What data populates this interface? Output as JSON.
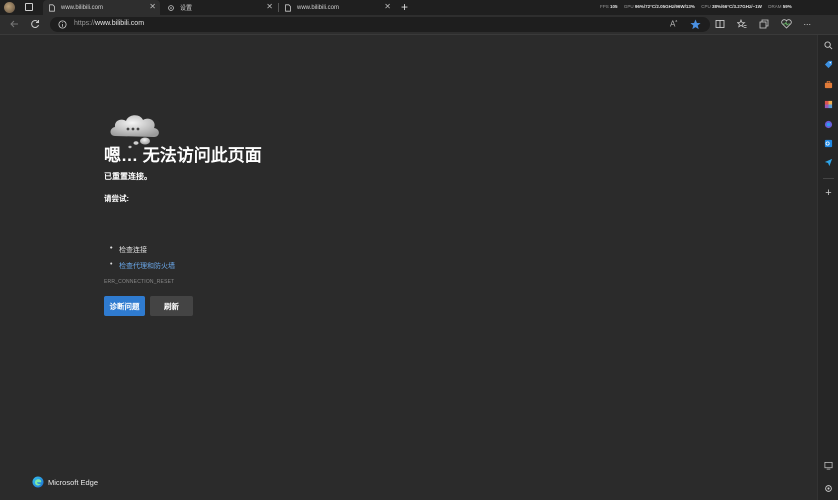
{
  "tabs": [
    {
      "title": "www.bilibili.com",
      "icon": "page-loading-icon",
      "active": true
    },
    {
      "title": "设置",
      "icon": "gear-icon",
      "active": false
    },
    {
      "title": "www.bilibili.com",
      "icon": "page-loading-icon",
      "active": false
    }
  ],
  "new_tab": "+",
  "stats": {
    "fps_label": "FPS",
    "fps_value": "105",
    "gpu_label": "GPU",
    "gpu_value": "96%/72°C/2.05GHz/96W/13%",
    "cpu_label": "CPU",
    "cpu_value": "38%/66°C/3.27GHz/~1W",
    "ram_label": "DRAM",
    "ram_value": "59%"
  },
  "address": {
    "url": "https://www.bilibili.com",
    "protocol": "https://",
    "host": "www.bilibili.com"
  },
  "error": {
    "title": "嗯… 无法访问此页面",
    "subtitle": "已重置连接。",
    "try_label": "请尝试:",
    "suggestions": [
      "检查连接",
      "检查代理和防火墙"
    ],
    "code": "ERR_CONNECTION_RESET",
    "diagnose_label": "诊断问题",
    "refresh_label": "刷新"
  },
  "footer": {
    "brand": "Microsoft Edge"
  },
  "colors": {
    "accent": "#2f7bd0",
    "link": "#6aa7e8",
    "background": "#2b2b2b",
    "favorite_star": "#4a90e2"
  }
}
